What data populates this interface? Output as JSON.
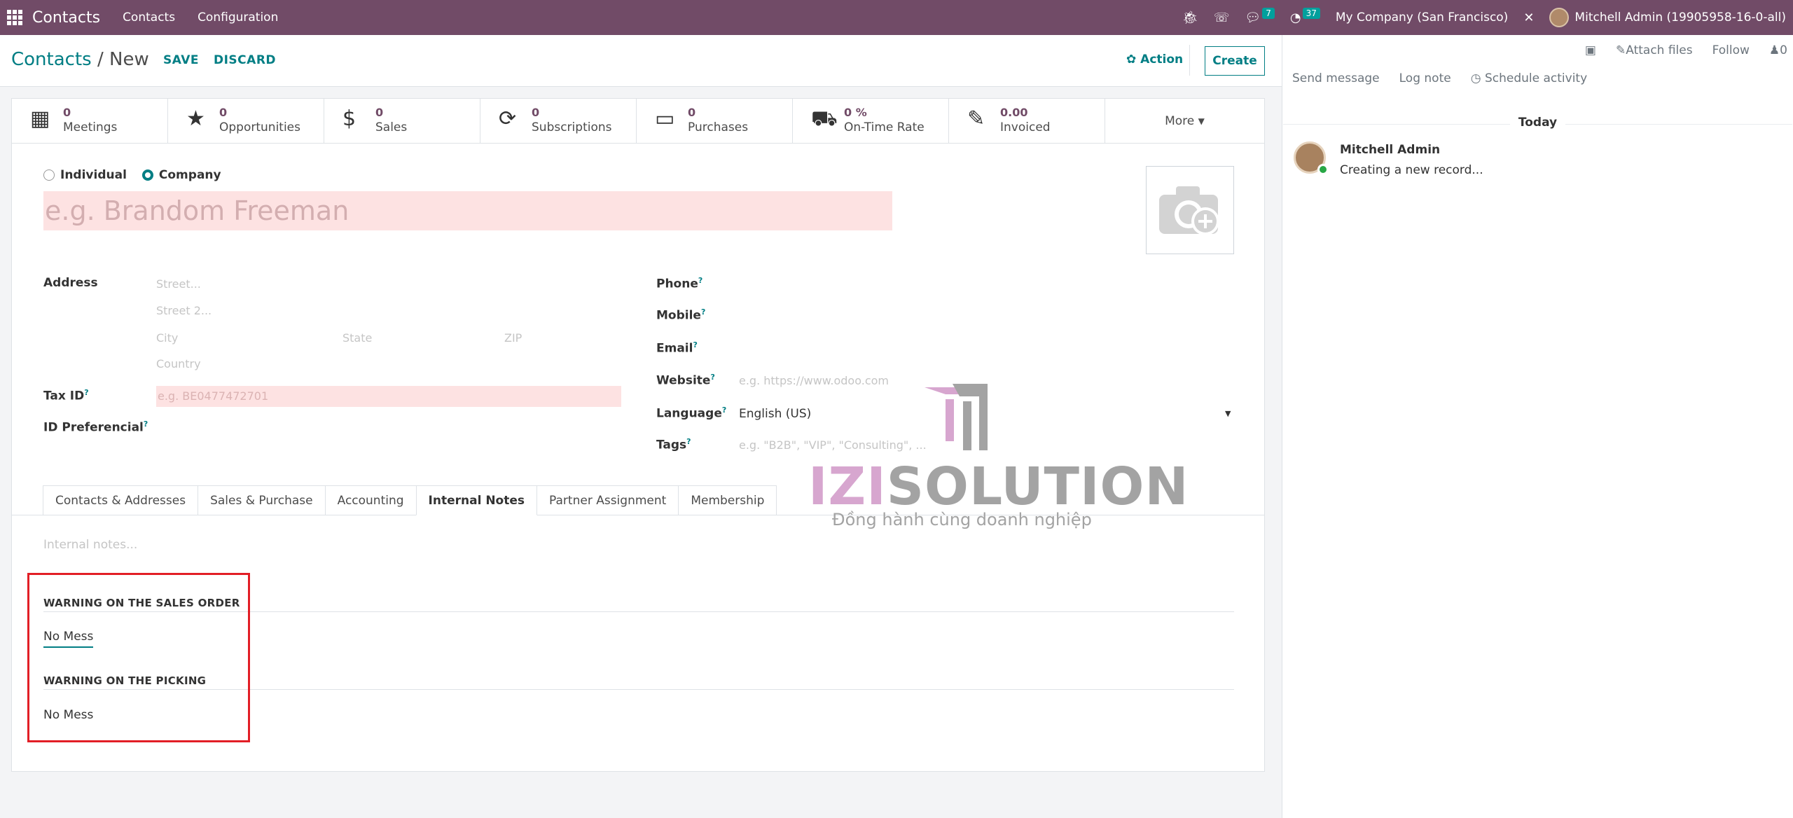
{
  "navbar": {
    "app_name": "Contacts",
    "menus": [
      "Contacts",
      "Configuration"
    ],
    "messages_count": "7",
    "activities_count": "37",
    "company": "My Company (San Francisco)",
    "user": "Mitchell Admin (19905958-16-0-all)"
  },
  "control": {
    "breadcrumb_parent": "Contacts",
    "breadcrumb_sep": " / ",
    "breadcrumb_current": "New",
    "save_label": "SAVE",
    "discard_label": "DISCARD",
    "action_label": "Action",
    "create_label": "Create"
  },
  "stats": [
    {
      "icon": "calendar-icon",
      "value": "0",
      "label": "Meetings"
    },
    {
      "icon": "star-icon",
      "value": "0",
      "label": "Opportunities"
    },
    {
      "icon": "dollar-icon",
      "value": "0",
      "label": "Sales"
    },
    {
      "icon": "refresh-icon",
      "value": "0",
      "label": "Subscriptions"
    },
    {
      "icon": "credit-card-icon",
      "value": "0",
      "label": "Purchases"
    },
    {
      "icon": "truck-icon",
      "value": "0 %",
      "label": "On-Time Rate"
    },
    {
      "icon": "edit-icon",
      "value": "0.00",
      "label": "Invoiced"
    }
  ],
  "more_label": "More",
  "form": {
    "radio_individual": "Individual",
    "radio_company": "Company",
    "name_placeholder": "e.g. Brandom Freeman",
    "address_label": "Address",
    "street_placeholder": "Street...",
    "street2_placeholder": "Street 2...",
    "city_placeholder": "City",
    "state_placeholder": "State",
    "zip_placeholder": "ZIP",
    "country_placeholder": "Country",
    "taxid_label": "Tax ID",
    "taxid_placeholder": "e.g. BE0477472701",
    "idpref_label": "ID Preferencial",
    "phone_label": "Phone",
    "mobile_label": "Mobile",
    "email_label": "Email",
    "website_label": "Website",
    "website_placeholder": "e.g. https://www.odoo.com",
    "language_label": "Language",
    "language_value": "English (US)",
    "tags_label": "Tags",
    "tags_placeholder": "e.g. \"B2B\", \"VIP\", \"Consulting\", ...",
    "help_mark": "?"
  },
  "tabs": [
    "Contacts & Addresses",
    "Sales & Purchase",
    "Accounting",
    "Internal Notes",
    "Partner Assignment",
    "Membership"
  ],
  "notes": {
    "placeholder": "Internal notes...",
    "warning_sale_title": "WARNING ON THE SALES ORDER",
    "warning_sale_value": "No Mess",
    "warning_picking_title": "WARNING ON THE PICKING",
    "warning_picking_value": "No Mess"
  },
  "chatter": {
    "send_message": "Send message",
    "log_note": "Log note",
    "schedule_activity": "Schedule activity",
    "attach_files": "Attach files",
    "follow": "Follow",
    "followers_count": "0",
    "today": "Today",
    "author": "Mitchell Admin",
    "body": "Creating a new record..."
  },
  "watermark": {
    "brand_a": "IZI",
    "brand_b": "SOLUTION",
    "tagline": "Đồng hành cùng doanh nghiệp"
  },
  "colors": {
    "navbar": "#714b67",
    "accent": "#017e84",
    "required_bg": "#fde2e2",
    "highlight_box": "#e21e26"
  }
}
